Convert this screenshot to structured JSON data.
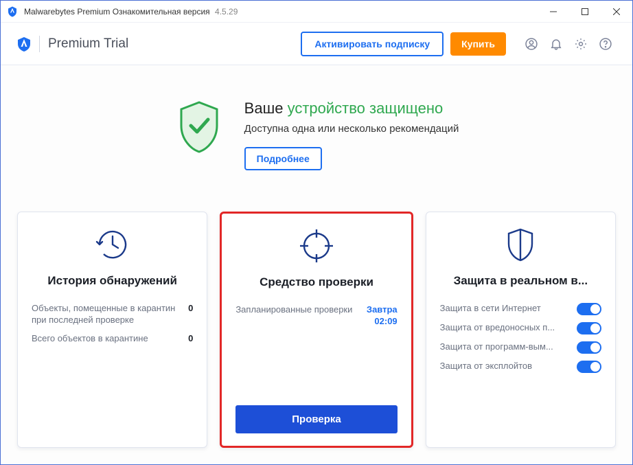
{
  "colors": {
    "accent": "#1d6ef0",
    "orange": "#ff8a00",
    "highlight_border": "#e22727",
    "green": "#2fa84f"
  },
  "titlebar": {
    "app_name": "Malwarebytes Premium Ознакомительная версия",
    "version": "4.5.29"
  },
  "header": {
    "title": "Premium Trial",
    "activate_label": "Активировать подписку",
    "buy_label": "Купить"
  },
  "status": {
    "prefix": "Ваше ",
    "protected": "устройство защищено",
    "subtitle": "Доступна одна или несколько рекомендаций",
    "more_label": "Подробнее"
  },
  "history_card": {
    "title": "История обнаружений",
    "rows": [
      {
        "label": "Объекты, помещенные в карантин при последней проверке",
        "value": "0"
      },
      {
        "label": "Всего объектов в карантине",
        "value": "0"
      }
    ]
  },
  "scanner_card": {
    "title": "Средство проверки",
    "scheduled_label": "Запланированные проверки",
    "scheduled_day": "Завтра",
    "scheduled_time": "02:09",
    "scan_button": "Проверка"
  },
  "realtime_card": {
    "title": "Защита в реальном в...",
    "items": [
      {
        "label": "Защита в сети Интернет",
        "on": true
      },
      {
        "label": "Защита от вредоносных п...",
        "on": true
      },
      {
        "label": "Защита от программ-вым...",
        "on": true
      },
      {
        "label": "Защита от эксплойтов",
        "on": true
      }
    ]
  }
}
